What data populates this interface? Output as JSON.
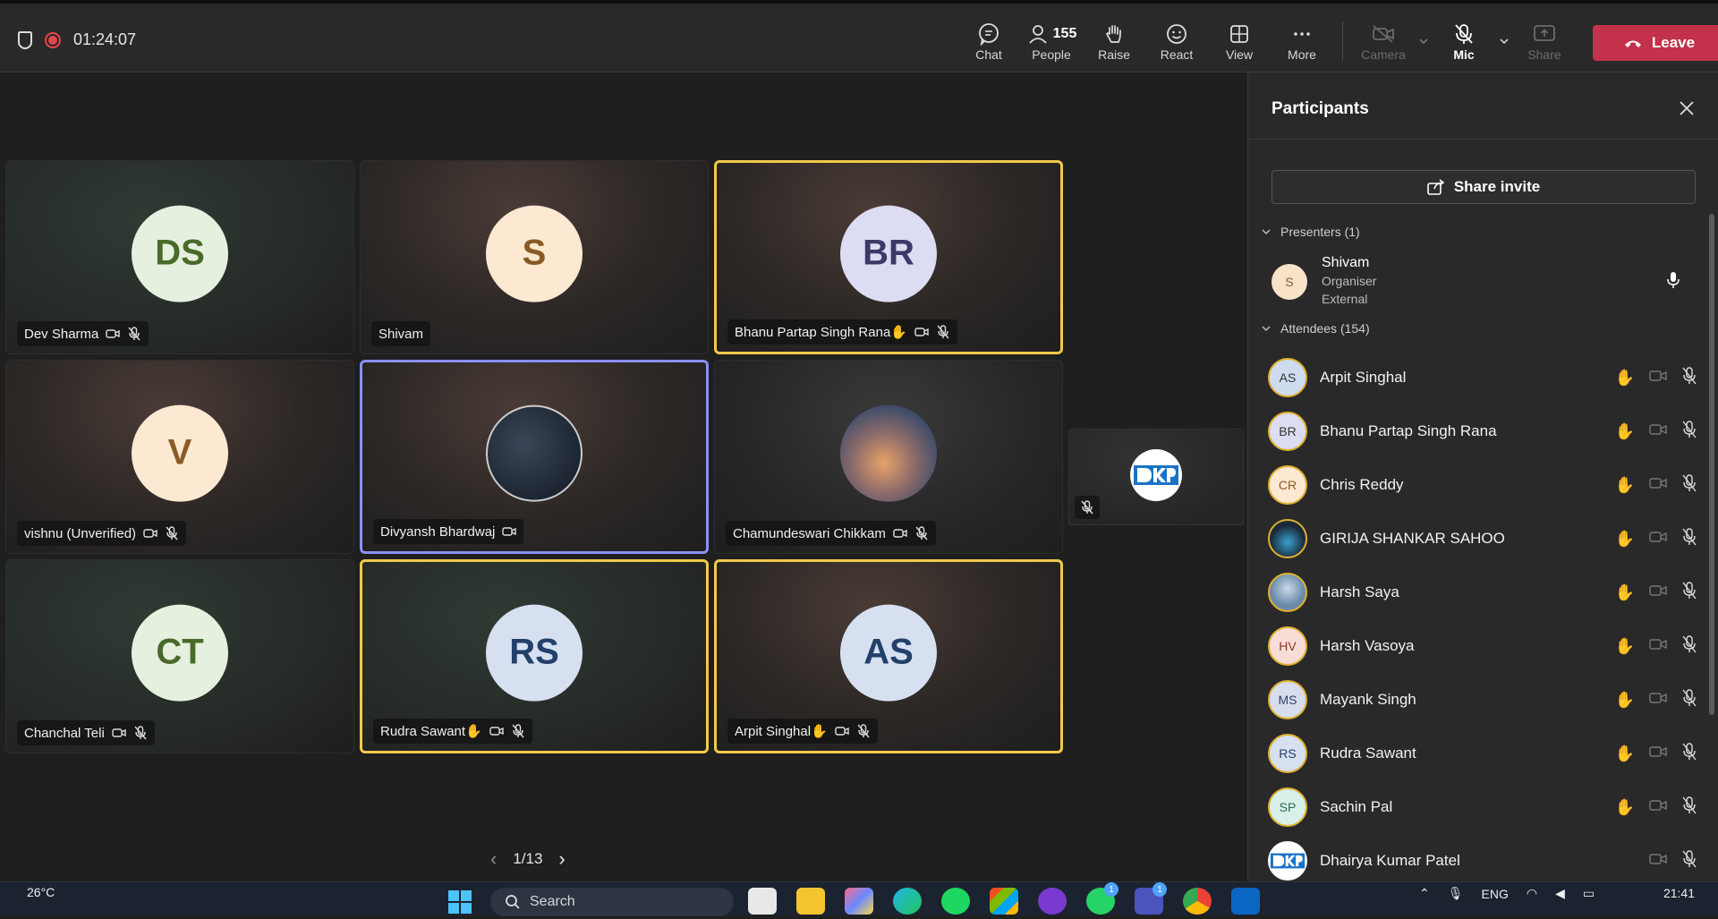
{
  "meeting": {
    "timer": "01:24:07"
  },
  "toolbar": {
    "chat": "Chat",
    "people": "People",
    "people_count": "155",
    "raise": "Raise",
    "react": "React",
    "view": "View",
    "more": "More",
    "camera": "Camera",
    "mic": "Mic",
    "share": "Share",
    "leave": "Leave"
  },
  "tiles": [
    {
      "initials": "DS",
      "name": "Dev Sharma",
      "bg": "#e6f0df",
      "fg": "#4a6a2a"
    },
    {
      "initials": "S",
      "name": "Shivam",
      "bg": "#fde9d2",
      "fg": "#8a5a25"
    },
    {
      "initials": "BR",
      "name": "Bhanu Partap Singh Rana✋",
      "bg": "#dcdcf2",
      "fg": "#3a3a6a"
    },
    {
      "initials": "V",
      "name": "vishnu (Unverified)",
      "bg": "#fde9d2",
      "fg": "#8a5a25"
    },
    {
      "initials": "",
      "name": "Divyansh Bhardwaj",
      "bg": "#1a2230",
      "fg": "#fff"
    },
    {
      "initials": "",
      "name": "Chamundeswari Chikkam",
      "bg": "#6a7a9a",
      "fg": "#fff"
    },
    {
      "initials": "CT",
      "name": "Chanchal Teli",
      "bg": "#e6f0df",
      "fg": "#4a6a2a"
    },
    {
      "initials": "RS",
      "name": "Rudra Sawant✋",
      "bg": "#d6e0f0",
      "fg": "#23406a"
    },
    {
      "initials": "AS",
      "name": "Arpit Singhal✋",
      "bg": "#d6e0f0",
      "fg": "#23406a"
    }
  ],
  "pager": {
    "label": "1/13"
  },
  "panel": {
    "title": "Participants",
    "invite": "Share invite",
    "presenters_header": "Presenters (1)",
    "presenter": {
      "initials": "S",
      "name": "Shivam",
      "role": "Organiser",
      "type": "External"
    },
    "attendees_header": "Attendees (154)",
    "attendees": [
      {
        "initials": "AS",
        "name": "Arpit Singhal",
        "bg": "#cfdcf0"
      },
      {
        "initials": "BR",
        "name": "Bhanu Partap Singh Rana",
        "bg": "#dcdcf2"
      },
      {
        "initials": "CR",
        "name": "Chris Reddy",
        "bg": "#fde9d2"
      },
      {
        "initials": "",
        "name": "GIRIJA SHANKAR SAHOO",
        "bg": "#1a2a3a"
      },
      {
        "initials": "",
        "name": "Harsh Saya",
        "bg": "#6a8aa8"
      },
      {
        "initials": "HV",
        "name": "Harsh Vasoya",
        "bg": "#f8dcd6"
      },
      {
        "initials": "MS",
        "name": "Mayank Singh",
        "bg": "#d6ddee"
      },
      {
        "initials": "RS",
        "name": "Rudra Sawant",
        "bg": "#d6e0f0"
      },
      {
        "initials": "SP",
        "name": "Sachin Pal",
        "bg": "#d8f0ea"
      },
      {
        "initials": "",
        "name": "Dhairya Kumar Patel",
        "bg": "#ffffff"
      }
    ]
  },
  "taskbar": {
    "temp": "26°C",
    "search": "Search",
    "lang": "ENG",
    "time": "21:41"
  },
  "colors": {
    "accent": "#7f85f5",
    "leave": "#c4314b",
    "raise": "#f2c94c"
  }
}
